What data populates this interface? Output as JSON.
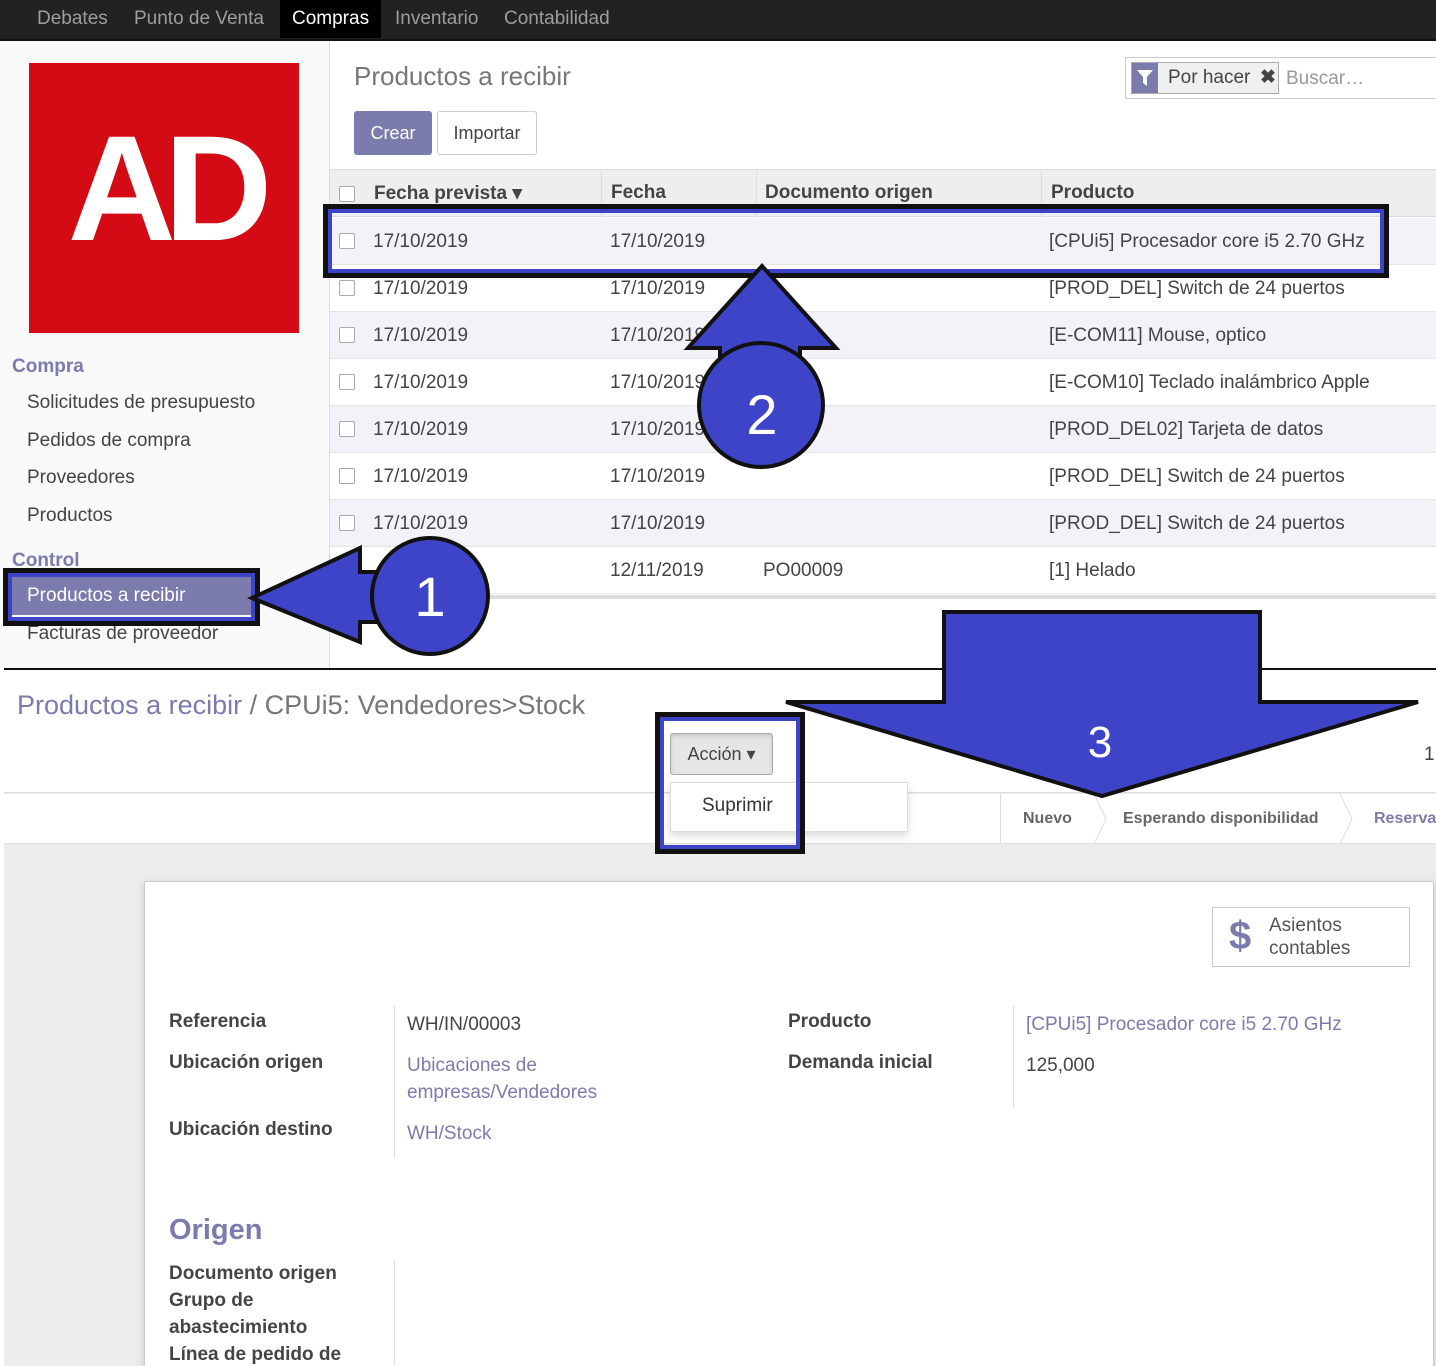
{
  "topnav": {
    "items": [
      {
        "label": "Debates"
      },
      {
        "label": "Punto de Venta"
      },
      {
        "label": "Compras",
        "active": true
      },
      {
        "label": "Inventario"
      },
      {
        "label": "Contabilidad"
      }
    ]
  },
  "logo": {
    "text": "AD",
    "color": "#d40a14"
  },
  "sidebar": {
    "section1": "Compra",
    "items1": [
      "Solicitudes de presupuesto",
      "Pedidos de compra",
      "Proveedores",
      "Productos"
    ],
    "section2": "Control",
    "active_item": "Productos a recibir",
    "items2": [
      "Facturas de proveedor"
    ]
  },
  "list": {
    "title": "Productos a recibir",
    "create_label": "Crear",
    "import_label": "Importar",
    "search": {
      "facet": "Por hacer",
      "placeholder": "Buscar…"
    },
    "columns": [
      "Fecha prevista",
      "Fecha",
      "Documento origen",
      "Producto"
    ],
    "rows": [
      {
        "fecha_prevista": "17/10/2019",
        "fecha": "17/10/2019",
        "documento": "",
        "producto": "[CPUi5] Procesador core i5 2.70 GHz"
      },
      {
        "fecha_prevista": "17/10/2019",
        "fecha": "17/10/2019",
        "documento": "",
        "producto": "[PROD_DEL] Switch de 24 puertos"
      },
      {
        "fecha_prevista": "17/10/2019",
        "fecha": "17/10/2019",
        "documento": "",
        "producto": "[E-COM11] Mouse, optico"
      },
      {
        "fecha_prevista": "17/10/2019",
        "fecha": "17/10/2019",
        "documento": "",
        "producto": "[E-COM10] Teclado inalámbrico Apple"
      },
      {
        "fecha_prevista": "17/10/2019",
        "fecha": "17/10/2019",
        "documento": "",
        "producto": "[PROD_DEL02] Tarjeta de datos"
      },
      {
        "fecha_prevista": "17/10/2019",
        "fecha": "17/10/2019",
        "documento": "",
        "producto": "[PROD_DEL] Switch de 24 puertos"
      },
      {
        "fecha_prevista": "17/10/2019",
        "fecha": "17/10/2019",
        "documento": "",
        "producto": "[PROD_DEL] Switch de 24 puertos"
      },
      {
        "fecha_prevista": "",
        "fecha": "12/11/2019",
        "documento": "PO00009",
        "producto": "[1] Helado"
      }
    ]
  },
  "form": {
    "breadcrumb_parent": "Productos a recibir",
    "breadcrumb_sep": " / ",
    "breadcrumb_current": "CPUi5: Vendedores>Stock",
    "action_label": "Acción",
    "action_menu_item": "Suprimir",
    "pager": "1",
    "statuses": [
      "Nuevo",
      "Esperando disponibilidad",
      "Reserva"
    ],
    "smart_button": {
      "icon": "$",
      "label": "Asientos contables"
    },
    "fields_left": [
      {
        "label": "Referencia",
        "value": "WH/IN/00003"
      },
      {
        "label": "Ubicación origen",
        "value": "Ubicaciones de empresas/Vendedores"
      },
      {
        "label": "Ubicación destino",
        "value": "WH/Stock"
      }
    ],
    "fields_right": [
      {
        "label": "Producto",
        "value": "[CPUi5] Procesador core i5 2.70 GHz"
      },
      {
        "label": "Demanda inicial",
        "value": "125,000"
      }
    ],
    "origen_heading": "Origen",
    "origen_fields": [
      "Documento origen",
      "Grupo de abastecimiento",
      "Línea de pedido de"
    ]
  },
  "annotations": {
    "step1": "1",
    "step2": "2",
    "step3": "3",
    "color": "#3e44c8"
  }
}
